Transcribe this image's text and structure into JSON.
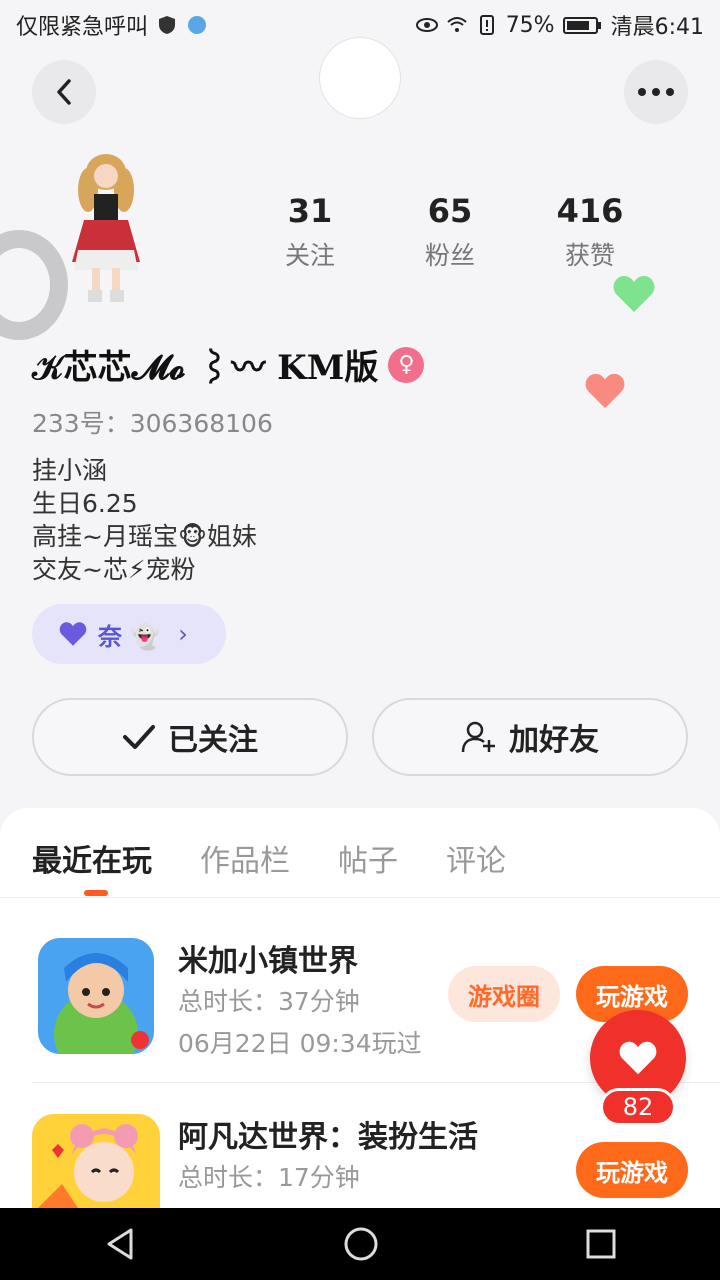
{
  "status_bar": {
    "carrier": "仅限紧急呼叫",
    "battery": "75%",
    "time": "清晨6:41"
  },
  "profile": {
    "stats": [
      {
        "num": "31",
        "label": "关注"
      },
      {
        "num": "65",
        "label": "粉丝"
      },
      {
        "num": "416",
        "label": "获赞"
      }
    ],
    "name": "𝒦芯芯𝓜𝓸 ⌇〰 KM版",
    "uid": "233号：306368106",
    "bio": "挂小涵\n生日6.25\n高挂~月瑶宝🐵姐妹\n交友~芯⚡宠粉",
    "tag_label": "奈 👻"
  },
  "actions": {
    "followed": "已关注",
    "add_friend": "加好友"
  },
  "tabs": [
    "最近在玩",
    "作品栏",
    "帖子",
    "评论"
  ],
  "games": [
    {
      "title": "米加小镇世界",
      "duration": "总时长：37分钟",
      "last_played": "06月22日 09:34玩过",
      "circle_btn": "游戏圈",
      "play_btn": "玩游戏"
    },
    {
      "title": "阿凡达世界：装扮生活",
      "duration": "总时长：17分钟",
      "play_btn": "玩游戏"
    }
  ],
  "like": {
    "count": "82"
  },
  "colors": {
    "accent": "#ff6a1a",
    "like": "#f0312b",
    "tag_bg": "#e6e4fb"
  }
}
